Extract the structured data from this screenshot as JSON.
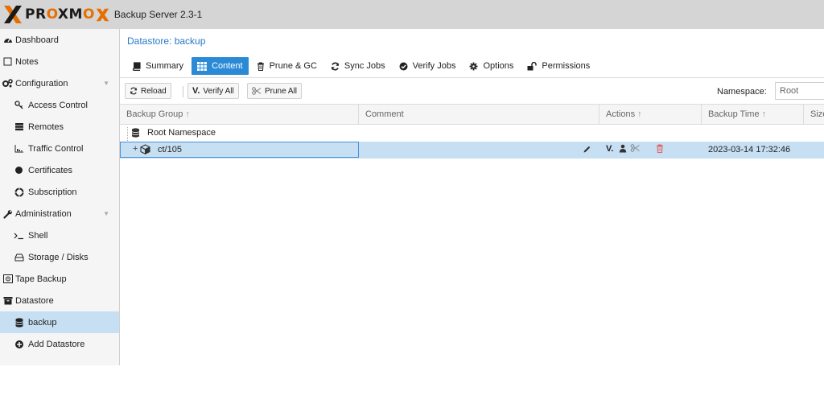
{
  "header": {
    "brand": {
      "part1": "PR",
      "o1": "O",
      "part2": "XM",
      "o2": "O",
      "x_color": "#e57000"
    },
    "version": "Backup Server 2.3-1"
  },
  "sidebar": {
    "items": [
      {
        "label": "Dashboard",
        "icon": "dashboard-icon",
        "level": 0
      },
      {
        "label": "Notes",
        "icon": "notes-icon",
        "level": 0
      },
      {
        "label": "Configuration",
        "icon": "gears-icon",
        "level": 0,
        "collapsible": true
      },
      {
        "label": "Access Control",
        "icon": "key-icon",
        "level": 1
      },
      {
        "label": "Remotes",
        "icon": "server-icon",
        "level": 1
      },
      {
        "label": "Traffic Control",
        "icon": "bar-chart-icon",
        "level": 1
      },
      {
        "label": "Certificates",
        "icon": "certificate-icon",
        "level": 1
      },
      {
        "label": "Subscription",
        "icon": "life-ring-icon",
        "level": 1
      },
      {
        "label": "Administration",
        "icon": "wrench-icon",
        "level": 0,
        "collapsible": true
      },
      {
        "label": "Shell",
        "icon": "terminal-icon",
        "level": 1
      },
      {
        "label": "Storage / Disks",
        "icon": "hdd-icon",
        "level": 1
      },
      {
        "label": "Tape Backup",
        "icon": "tape-icon",
        "level": 0
      },
      {
        "label": "Datastore",
        "icon": "archive-icon",
        "level": 0
      },
      {
        "label": "backup",
        "icon": "database-icon",
        "level": 1,
        "selected": true
      },
      {
        "label": "Add Datastore",
        "icon": "plus-circle-icon",
        "level": 1
      }
    ]
  },
  "main": {
    "title": "Datastore: backup",
    "tabs": [
      {
        "label": "Summary",
        "icon": "book-icon"
      },
      {
        "label": "Content",
        "icon": "grid-icon",
        "active": true
      },
      {
        "label": "Prune & GC",
        "icon": "trash-icon"
      },
      {
        "label": "Sync Jobs",
        "icon": "refresh-icon"
      },
      {
        "label": "Verify Jobs",
        "icon": "check-circle-icon"
      },
      {
        "label": "Options",
        "icon": "gear-icon"
      },
      {
        "label": "Permissions",
        "icon": "unlock-icon"
      }
    ],
    "toolbar": {
      "reload": "Reload",
      "verify_all": "Verify All",
      "prune_all": "Prune All",
      "namespace_label": "Namespace:",
      "namespace_value": "Root"
    },
    "grid": {
      "columns": [
        "Backup Group",
        "Comment",
        "Actions",
        "Backup Time",
        "Size"
      ],
      "sortable": [
        true,
        false,
        true,
        true,
        false
      ],
      "rows": [
        {
          "type": "namespace",
          "label": "Root Namespace"
        },
        {
          "type": "group",
          "label": "ct/105",
          "backup_time": "2023-03-14 17:32:46",
          "selected": true
        }
      ]
    },
    "colors": {
      "accent": "#2a8ad6",
      "link": "#2a78c8",
      "selection": "#c7dff3",
      "danger": "#e06666"
    }
  }
}
